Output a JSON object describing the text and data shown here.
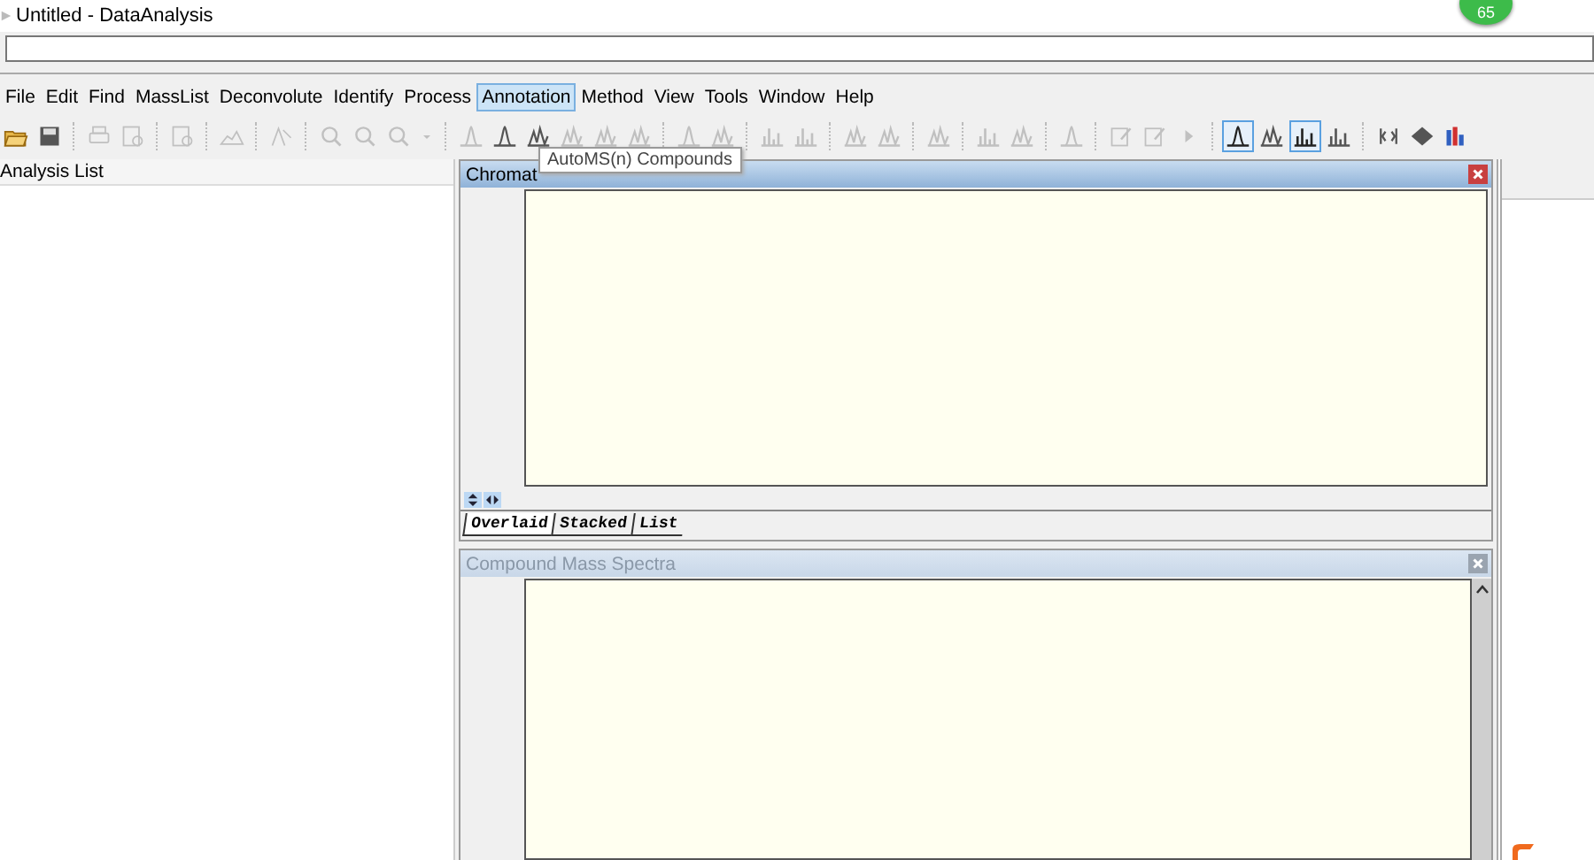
{
  "window": {
    "title": "Untitled - DataAnalysis"
  },
  "notification_badge": {
    "count": "65"
  },
  "menu": [
    {
      "label": "File",
      "selected": false
    },
    {
      "label": "Edit",
      "selected": false
    },
    {
      "label": "Find",
      "selected": false
    },
    {
      "label": "MassList",
      "selected": false
    },
    {
      "label": "Deconvolute",
      "selected": false
    },
    {
      "label": "Identify",
      "selected": false
    },
    {
      "label": "Process",
      "selected": false
    },
    {
      "label": "Annotation",
      "selected": true
    },
    {
      "label": "Method",
      "selected": false
    },
    {
      "label": "View",
      "selected": false
    },
    {
      "label": "Tools",
      "selected": false
    },
    {
      "label": "Window",
      "selected": false
    },
    {
      "label": "Help",
      "selected": false
    }
  ],
  "toolbar": [
    [
      {
        "kind": "open",
        "selected": false,
        "disabled": false
      },
      {
        "kind": "save",
        "selected": false,
        "disabled": false
      }
    ],
    [
      {
        "kind": "print",
        "selected": false,
        "disabled": true
      },
      {
        "kind": "preview",
        "selected": false,
        "disabled": true
      }
    ],
    [
      {
        "kind": "properties",
        "selected": false,
        "disabled": true
      }
    ],
    [
      {
        "kind": "area",
        "selected": false,
        "disabled": true
      }
    ],
    [
      {
        "kind": "edit-peak",
        "selected": false,
        "disabled": true
      }
    ],
    [
      {
        "kind": "zoom-back",
        "selected": false,
        "disabled": true
      },
      {
        "kind": "zoom-forward",
        "selected": false,
        "disabled": true
      },
      {
        "kind": "search",
        "selected": false,
        "disabled": true
      },
      {
        "kind": "dropdown",
        "selected": false,
        "disabled": true
      }
    ],
    [
      {
        "kind": "peak",
        "selected": false,
        "disabled": true
      },
      {
        "kind": "peak",
        "selected": false,
        "disabled": false
      },
      {
        "kind": "peaks",
        "selected": false,
        "disabled": false
      },
      {
        "kind": "peaks",
        "selected": false,
        "disabled": true
      },
      {
        "kind": "peaks",
        "selected": false,
        "disabled": true
      },
      {
        "kind": "peaks",
        "selected": false,
        "disabled": true
      }
    ],
    [
      {
        "kind": "peak",
        "selected": false,
        "disabled": true
      },
      {
        "kind": "peaks",
        "selected": false,
        "disabled": true
      }
    ],
    [
      {
        "kind": "bars",
        "selected": false,
        "disabled": true
      },
      {
        "kind": "bars",
        "selected": false,
        "disabled": true
      }
    ],
    [
      {
        "kind": "peaks",
        "selected": false,
        "disabled": true
      },
      {
        "kind": "peaks",
        "selected": false,
        "disabled": true
      }
    ],
    [
      {
        "kind": "peaks",
        "selected": false,
        "disabled": true
      }
    ],
    [
      {
        "kind": "bars",
        "selected": false,
        "disabled": true
      },
      {
        "kind": "peaks",
        "selected": false,
        "disabled": true
      }
    ],
    [
      {
        "kind": "peak",
        "selected": false,
        "disabled": true
      }
    ],
    [
      {
        "kind": "edit",
        "selected": false,
        "disabled": true
      },
      {
        "kind": "edit",
        "selected": false,
        "disabled": true
      },
      {
        "kind": "play",
        "selected": false,
        "disabled": true
      }
    ],
    [
      {
        "kind": "peak",
        "selected": true,
        "disabled": false
      },
      {
        "kind": "peaks",
        "selected": false,
        "disabled": false
      },
      {
        "kind": "bars",
        "selected": true,
        "disabled": false
      },
      {
        "kind": "bars",
        "selected": false,
        "disabled": false
      }
    ],
    [
      {
        "kind": "split",
        "selected": false,
        "disabled": false
      },
      {
        "kind": "diamond",
        "selected": false,
        "disabled": false
      },
      {
        "kind": "color-bars",
        "selected": false,
        "disabled": false
      }
    ]
  ],
  "tooltip": {
    "text": "AutoMS(n) Compounds"
  },
  "analysis_list": {
    "title": "Analysis List"
  },
  "chromatogram": {
    "title": "Chromat",
    "active": true,
    "tabs": [
      {
        "label": "Overlaid",
        "selected": true
      },
      {
        "label": "Stacked",
        "selected": false
      },
      {
        "label": "List",
        "selected": false
      }
    ]
  },
  "mass_spectra": {
    "title": "Compound Mass Spectra",
    "active": false
  }
}
